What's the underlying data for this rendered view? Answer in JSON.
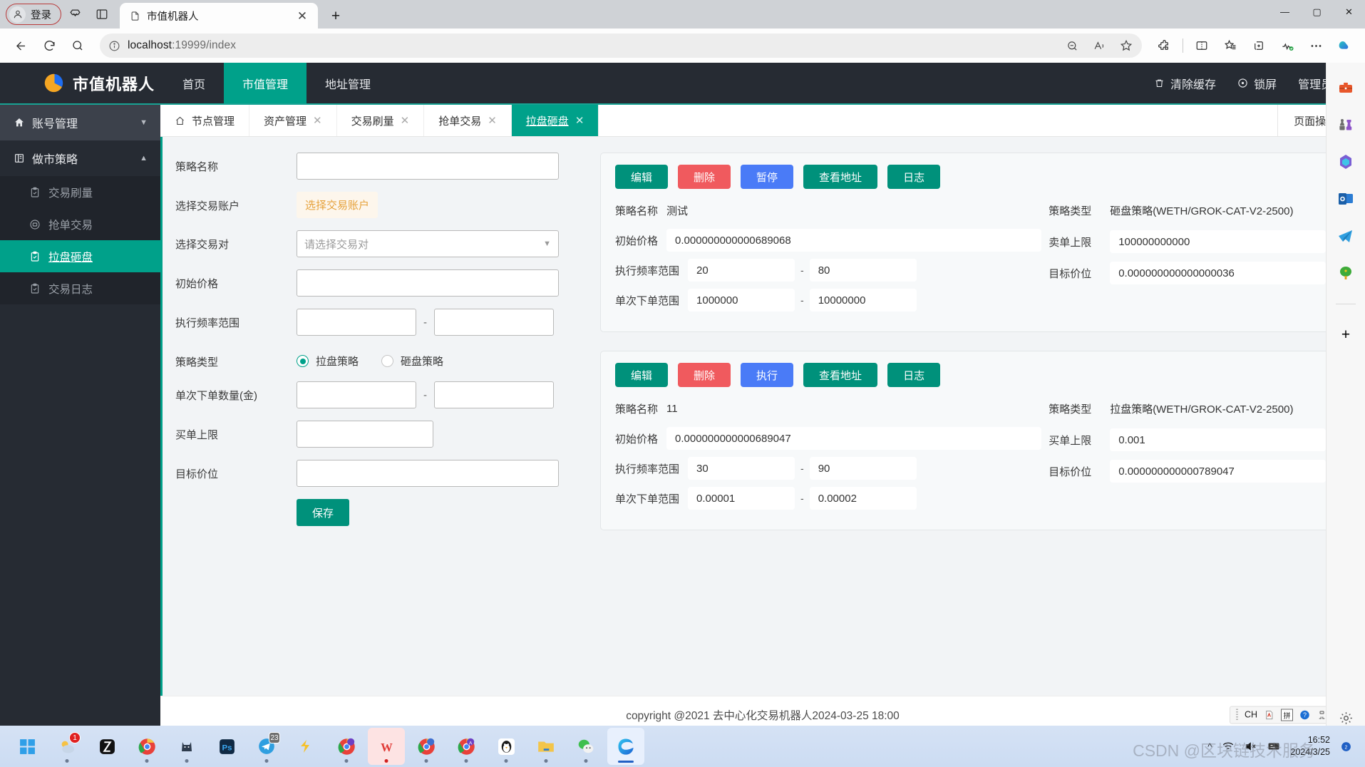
{
  "browser": {
    "profile_label": "登录",
    "tab_title": "市值机器人",
    "url_host": "localhost",
    "url_rest": ":19999/index",
    "new_tab_glyph": "+",
    "close_glyph": "✕",
    "win_minimize": "—",
    "win_maximize": "▢",
    "win_close": "✕",
    "icons": {
      "back": "back-arrow-icon",
      "refresh": "refresh-icon",
      "search": "search-icon",
      "info": "info-circle-icon",
      "zoom_out": "zoom-out-icon",
      "read_aloud": "read-aloud-icon",
      "favorite": "star-icon",
      "extensions": "extensions-icon",
      "split_screen": "split-screen-icon",
      "collections": "collections-icon",
      "add_tab_group": "add-to-collections-icon",
      "browser_essentials": "browser-essentials-icon",
      "settings_more": "more-options-icon",
      "copilot": "copilot-icon"
    }
  },
  "header": {
    "brand": "市值机器人",
    "nav": [
      {
        "label": "首页",
        "active": false
      },
      {
        "label": "市值管理",
        "active": true
      },
      {
        "label": "地址管理",
        "active": false
      }
    ],
    "clear_cache": "清除缓存",
    "lock_screen": "锁屏",
    "user": "管理员",
    "user_caret": "▼"
  },
  "sidebar": {
    "groups": [
      {
        "label": "账号管理",
        "caret": "▼",
        "expanded": false
      },
      {
        "label": "做市策略",
        "caret": "▲",
        "expanded": true
      }
    ],
    "items": [
      {
        "label": "交易刷量",
        "active": false
      },
      {
        "label": "抢单交易",
        "active": false
      },
      {
        "label": "拉盘砸盘",
        "active": true
      },
      {
        "label": "交易日志",
        "active": false
      }
    ]
  },
  "content_tabs": {
    "tabs": [
      {
        "label": "节点管理",
        "closable": false,
        "active": false,
        "home": true
      },
      {
        "label": "资产管理",
        "closable": true,
        "active": false
      },
      {
        "label": "交易刷量",
        "closable": true,
        "active": false
      },
      {
        "label": "抢单交易",
        "closable": true,
        "active": false
      },
      {
        "label": "拉盘砸盘",
        "closable": true,
        "active": true
      }
    ],
    "close_glyph": "✕",
    "page_ops": "页面操作",
    "page_ops_caret": "▼"
  },
  "form": {
    "fields": {
      "strategy_name_label": "策略名称",
      "strategy_name_value": "",
      "select_account_label": "选择交易账户",
      "select_account_button": "选择交易账户",
      "select_pair_label": "选择交易对",
      "select_pair_placeholder": "请选择交易对",
      "init_price_label": "初始价格",
      "init_price_value": "",
      "freq_range_label": "执行频率范围",
      "freq_min_value": "",
      "freq_max_value": "",
      "range_separator": "-",
      "strategy_type_label": "策略类型",
      "order_qty_label": "单次下单数量(金)",
      "order_qty_min": "",
      "order_qty_max": "",
      "buy_limit_label": "买单上限",
      "buy_limit_value": "",
      "target_price_label": "目标价位",
      "target_price_value": ""
    },
    "radio_options": [
      {
        "label": "拉盘策略",
        "selected": true
      },
      {
        "label": "砸盘策略",
        "selected": false
      }
    ],
    "save_button": "保存"
  },
  "cards": [
    {
      "buttons": [
        {
          "label": "编辑",
          "color": "teal"
        },
        {
          "label": "删除",
          "color": "red"
        },
        {
          "label": "暂停",
          "color": "blue"
        },
        {
          "label": "查看地址",
          "color": "teal"
        },
        {
          "label": "日志",
          "color": "teal"
        }
      ],
      "name_label": "策略名称",
      "name_value": "测试",
      "init_price_label": "初始价格",
      "init_price_value": "0.000000000000689068",
      "freq_label": "执行频率范围",
      "freq_min": "20",
      "freq_max": "80",
      "order_range_label": "单次下单范围",
      "order_min": "1000000",
      "order_max": "10000000",
      "type_label": "策略类型",
      "type_value": "砸盘策略(WETH/GROK-CAT-V2-2500)",
      "limit_label": "卖单上限",
      "limit_value": "100000000000",
      "target_label": "目标价位",
      "target_value": "0.000000000000000036",
      "separator": "-"
    },
    {
      "buttons": [
        {
          "label": "编辑",
          "color": "teal"
        },
        {
          "label": "删除",
          "color": "red"
        },
        {
          "label": "执行",
          "color": "blue"
        },
        {
          "label": "查看地址",
          "color": "teal"
        },
        {
          "label": "日志",
          "color": "teal"
        }
      ],
      "name_label": "策略名称",
      "name_value": "11",
      "init_price_label": "初始价格",
      "init_price_value": "0.000000000000689047",
      "freq_label": "执行频率范围",
      "freq_min": "30",
      "freq_max": "90",
      "order_range_label": "单次下单范围",
      "order_min": "0.00001",
      "order_max": "0.00002",
      "type_label": "策略类型",
      "type_value": "拉盘策略(WETH/GROK-CAT-V2-2500)",
      "limit_label": "买单上限",
      "limit_value": "0.001",
      "target_label": "目标价位",
      "target_value": "0.000000000000789047",
      "separator": "-"
    }
  ],
  "footer": {
    "copyright": "copyright @2021 去中心化交易机器人2024-03-25 18:00",
    "ime": {
      "lang": "CH",
      "pinyin": "拼",
      "help": "?"
    }
  },
  "taskbar": {
    "start": "windows-start-icon",
    "apps": [
      {
        "name": "start-button",
        "glyph": "⊞",
        "running": false
      },
      {
        "name": "weather-app",
        "glyph": "☁",
        "badge": "1",
        "running": true
      },
      {
        "name": "capcut-app",
        "glyph": "✖",
        "running": false
      },
      {
        "name": "chrome-app",
        "glyph": "◉",
        "running": true
      },
      {
        "name": "cat-app",
        "glyph": "🐱",
        "running": true
      },
      {
        "name": "photoshop-app",
        "glyph": "Ps",
        "running": false
      },
      {
        "name": "telegram-app",
        "glyph": "✈",
        "badge": "23",
        "badge_gray": true,
        "running": true
      },
      {
        "name": "lightning-app",
        "glyph": "⚡",
        "running": false
      },
      {
        "name": "chrome-profile-app",
        "glyph": "◉",
        "running": true
      },
      {
        "name": "wps-app",
        "glyph": "W",
        "highlight": true,
        "running": true
      },
      {
        "name": "chrome-contact-app",
        "glyph": "◉",
        "running": true
      },
      {
        "name": "chrome-a-app",
        "glyph": "◉",
        "running": true
      },
      {
        "name": "qq-app",
        "glyph": "🐧",
        "running": true
      },
      {
        "name": "file-explorer-app",
        "glyph": "📁",
        "running": true
      },
      {
        "name": "wechat-app",
        "glyph": "💬",
        "running": true
      },
      {
        "name": "edge-app",
        "glyph": "C",
        "highlight2": true,
        "running": true
      }
    ],
    "tray": {
      "chevron": "^",
      "network": "wifi-icon",
      "volume": "volume-muted-icon",
      "ime": "ime-icon",
      "time": "16:52",
      "date": "2024/3/25"
    },
    "watermark": "CSDN @区块链技术服务"
  },
  "edge_rail": {
    "icons": [
      "toolbox-icon",
      "chess-icon",
      "office-icon",
      "outlook-icon",
      "telegram-icon",
      "tree-game-icon"
    ],
    "add": "+",
    "settings": "gear-icon"
  },
  "colors": {
    "brand_dark": "#262b33",
    "accent_teal": "#00a18a",
    "btn_teal": "#00917b",
    "btn_red": "#f05a5e",
    "btn_blue": "#4a7bf7",
    "warn_orange": "#e6a23c",
    "page_bg": "#f2f4f6"
  }
}
